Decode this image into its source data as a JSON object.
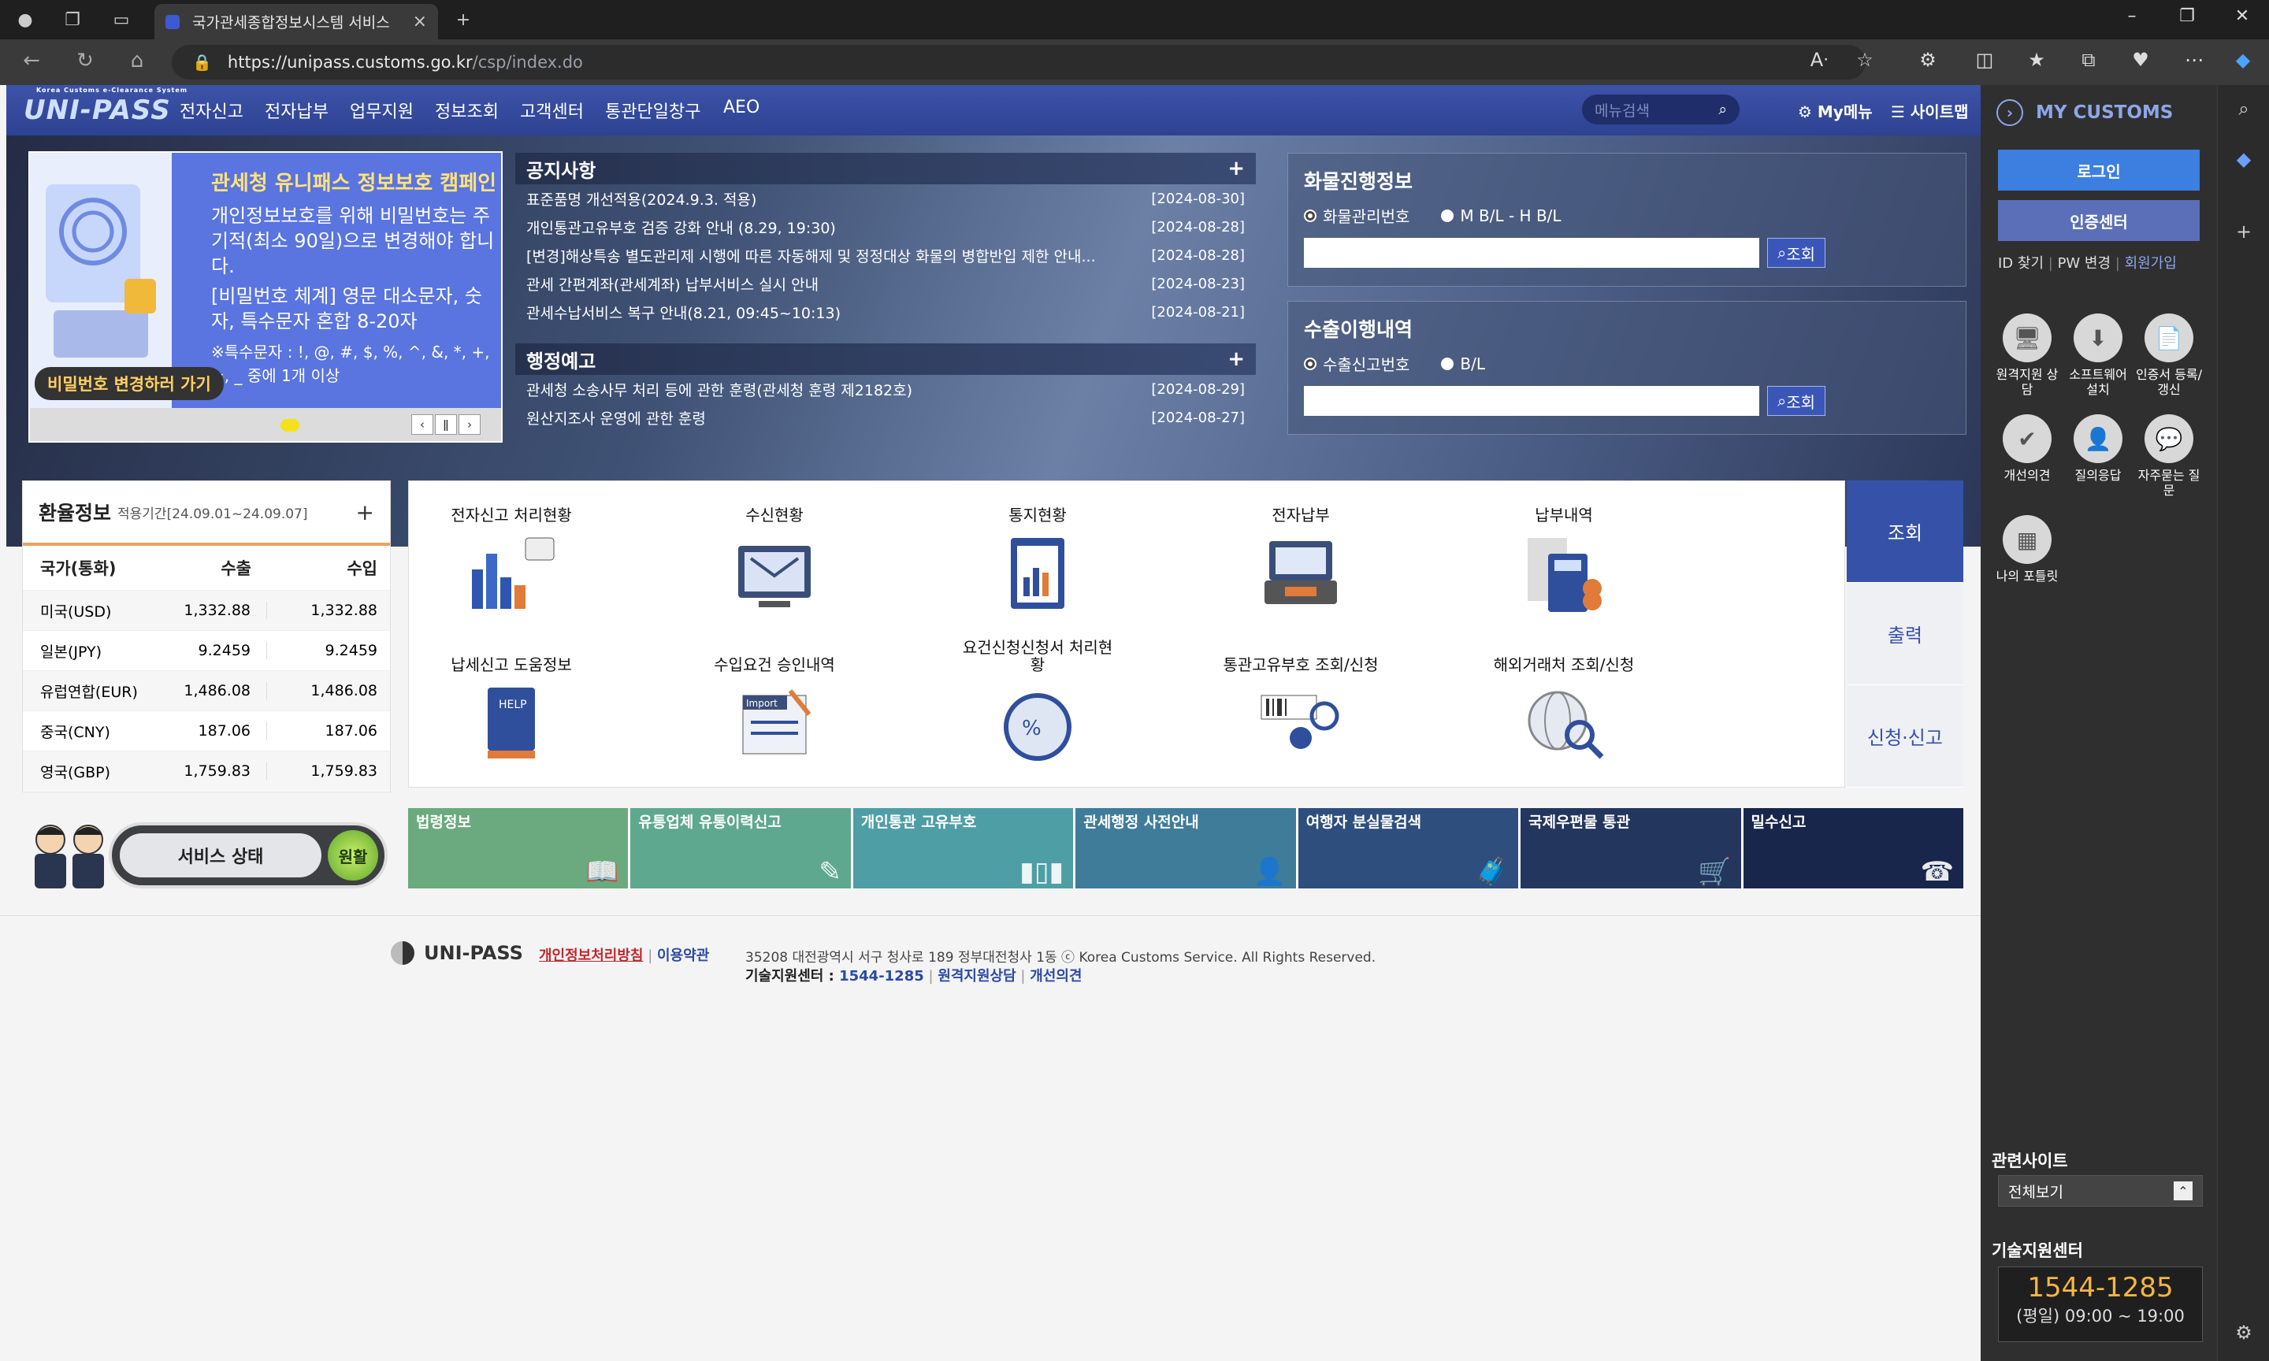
{
  "browser": {
    "tab_title": "국가관세종합정보시스템 서비스",
    "url_host": "https://unipass.customs.go.kr",
    "url_path": "/csp/index.do"
  },
  "gnb": {
    "logo": "UNI-PASS",
    "logo_small": "Korea Customs e-Clearance System",
    "menus": [
      "전자신고",
      "전자납부",
      "업무지원",
      "정보조회",
      "고객센터",
      "통관단일창구",
      "AEO"
    ],
    "search_placeholder": "메뉴검색",
    "mymenu": "My메뉴",
    "sitemap": "사이트맵"
  },
  "banner": {
    "headline": "관세청 유니패스 정보보호 캠페인",
    "body": "개인정보보호를 위해 비밀번호는 주기적(최소 90일)으로 변경해야 합니다.",
    "rule": "[비밀번호 체계] 영문 대소문자, 숫자, 특수문자 혼합 8-20자",
    "special": "※특수문자 : !, @, #, $, %, ^, &, *, +, =, _ 중에 1개 이상",
    "cta": "비밀번호 변경하러 가기"
  },
  "notice": {
    "title": "공지사항",
    "items": [
      {
        "text": "표준품명 개선적용(2024.9.3. 적용)",
        "date": "[2024-08-30]"
      },
      {
        "text": "개인통관고유부호 검증 강화 안내 (8.29, 19:30)",
        "date": "[2024-08-28]"
      },
      {
        "text": "[변경]해상특송 별도관리제 시행에 따른 자동해제 및 정정대상 화물의 병합반입 제한 안내...",
        "date": "[2024-08-28]"
      },
      {
        "text": "관세 간편계좌(관세계좌) 납부서비스 실시 안내",
        "date": "[2024-08-23]"
      },
      {
        "text": "관세수납서비스 복구 안내(8.21, 09:45~10:13)",
        "date": "[2024-08-21]"
      }
    ]
  },
  "admin": {
    "title": "행정예고",
    "items": [
      {
        "text": "관세청 소송사무 처리 등에 관한 훈령(관세청 훈령 제2182호)",
        "date": "[2024-08-29]"
      },
      {
        "text": "원산지조사 운영에 관한 훈령",
        "date": "[2024-08-27]"
      }
    ]
  },
  "cargo": {
    "title": "화물진행정보",
    "opt1": "화물관리번호",
    "opt2": "M B/L - H B/L",
    "btn": "조회"
  },
  "export": {
    "title": "수출이행내역",
    "opt1": "수출신고번호",
    "opt2": "B/L",
    "btn": "조회"
  },
  "exchange": {
    "title": "환율정보",
    "period": "적용기간[24.09.01~24.09.07]",
    "headers": [
      "국가(통화)",
      "수출",
      "수입"
    ],
    "rows": [
      [
        "미국(USD)",
        "1,332.88",
        "1,332.88"
      ],
      [
        "일본(JPY)",
        "9.2459",
        "9.2459"
      ],
      [
        "유럽연합(EUR)",
        "1,486.08",
        "1,486.08"
      ],
      [
        "중국(CNY)",
        "187.06",
        "187.06"
      ],
      [
        "영국(GBP)",
        "1,759.83",
        "1,759.83"
      ]
    ]
  },
  "service": {
    "label": "서비스 상태",
    "status": "원활"
  },
  "quick": {
    "items": [
      "전자신고 처리현황",
      "수신현황",
      "통지현황",
      "전자납부",
      "납부내역",
      "납세신고 도움정보",
      "수입요건 승인내역",
      "요건신청신청서 처리현황",
      "통관고유부호 조회/신청",
      "해외거래처 조회/신청"
    ],
    "tabs": [
      "조회",
      "출력",
      "신청·신고"
    ]
  },
  "links": [
    {
      "label": "법령정보",
      "color": "#6aaa7e"
    },
    {
      "label": "유통업체 유통이력신고",
      "color": "#5ea890"
    },
    {
      "label": "개인통관 고유부호",
      "color": "#4e9ea6"
    },
    {
      "label": "관세행정 사전안내",
      "color": "#3f7c9a"
    },
    {
      "label": "여행자 분실물검색",
      "color": "#2e4f7e"
    },
    {
      "label": "국제우편물 통관",
      "color": "#23365e"
    },
    {
      "label": "밀수신고",
      "color": "#17264a"
    }
  ],
  "footer": {
    "logo": "UNI-PASS",
    "privacy": "개인정보처리방침",
    "terms": "이용약관",
    "address": "35208 대전광역시 서구 청사로 189 정부대전청사 1동 ⓒ Korea Customs Service. All Rights Reserved.",
    "tech_label": "기술지원센터 : ",
    "tech_no": "1544-1285",
    "remote": "원격지원상담",
    "improve": "개선의견"
  },
  "side": {
    "title": "MY CUSTOMS",
    "login": "로그인",
    "cert": "인증센터",
    "find_id": "ID 찾기",
    "pw": "PW 변경",
    "join": "회원가입",
    "icons": [
      "원격지원 상담",
      "소프트웨어 설치",
      "인증서 등록/갱신",
      "개선의견",
      "질의응답",
      "자주묻는 질문",
      "나의 포틀릿"
    ],
    "related": "관련사이트",
    "related_sel": "전체보기",
    "tech": "기술지원센터",
    "tel": "1544-1285",
    "hours": "(평일) 09:00 ~ 19:00"
  }
}
